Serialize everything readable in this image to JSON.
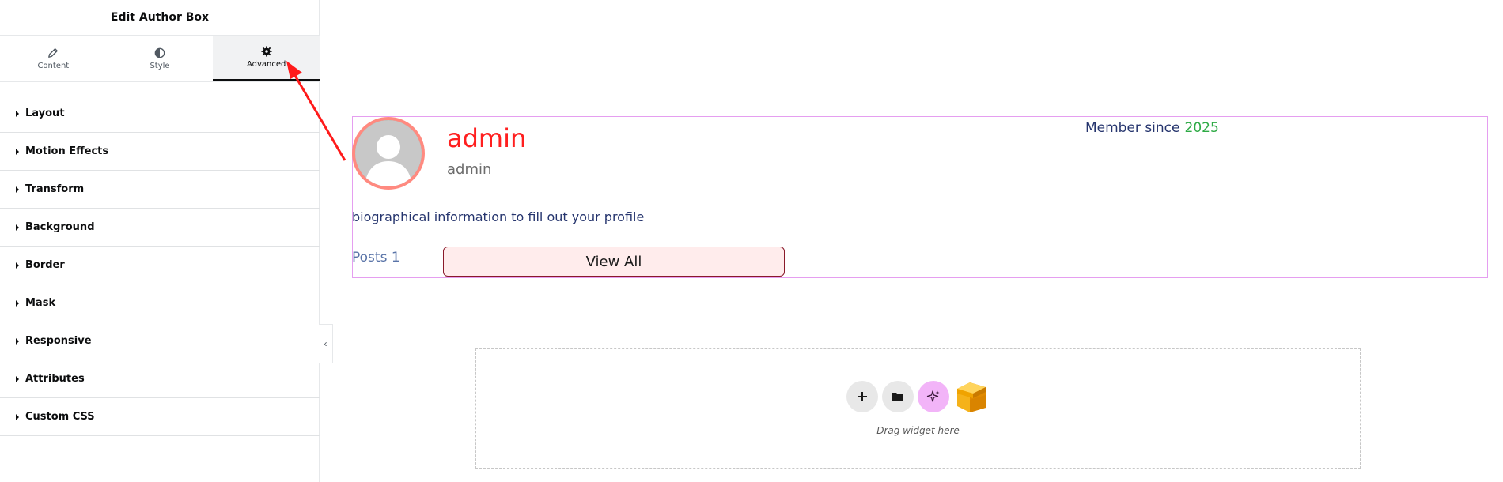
{
  "panel": {
    "title": "Edit Author Box",
    "tabs": [
      {
        "label": "Content",
        "icon": "pencil-icon",
        "active": false
      },
      {
        "label": "Style",
        "icon": "contrast-icon",
        "active": false
      },
      {
        "label": "Advanced",
        "icon": "gear-icon",
        "active": true
      }
    ],
    "sections": [
      {
        "label": "Layout"
      },
      {
        "label": "Motion Effects"
      },
      {
        "label": "Transform"
      },
      {
        "label": "Background"
      },
      {
        "label": "Border"
      },
      {
        "label": "Mask"
      },
      {
        "label": "Responsive"
      },
      {
        "label": "Attributes"
      },
      {
        "label": "Custom CSS"
      }
    ]
  },
  "author_box": {
    "name": "admin",
    "username": "admin",
    "member_since_label": "Member since",
    "member_since_year": "2025",
    "bio": "biographical information to fill out your profile",
    "posts_label": "Posts 1",
    "button_label": "View All",
    "colors": {
      "name": "#ff1f1f",
      "member_year": "#2eaa45",
      "text": "#26356e",
      "border": "#e59ef0",
      "button_bg": "#ffecec"
    }
  },
  "drop_zone": {
    "hint": "Drag widget here",
    "buttons": [
      "add-icon",
      "folder-icon",
      "sparkle-icon",
      "cube-icon"
    ]
  },
  "annotation": {
    "color": "#ff1a1a"
  }
}
